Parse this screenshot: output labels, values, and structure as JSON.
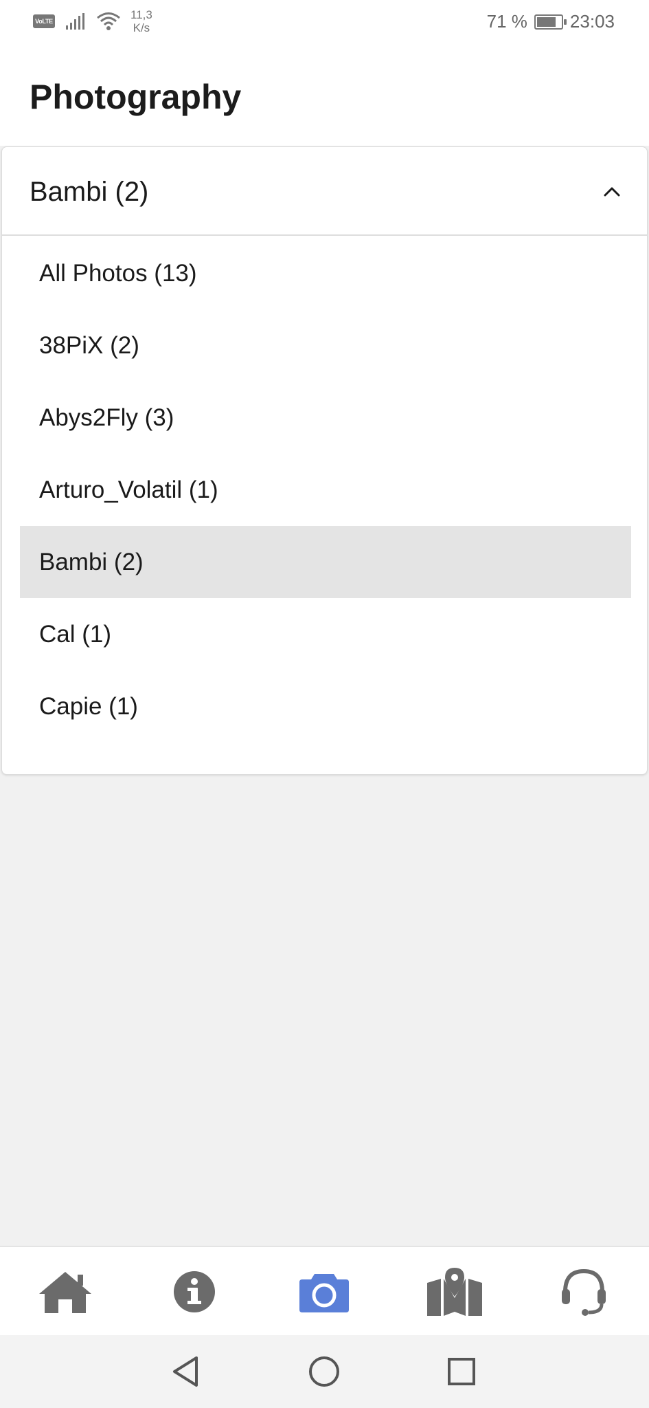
{
  "status_bar": {
    "network_badge": "VoLTE",
    "net_speed_value": "11,3",
    "net_speed_unit": "K/s",
    "battery": "71 %",
    "time": "23:03"
  },
  "header": {
    "title": "Photography"
  },
  "dropdown": {
    "selected": "Bambi (2)",
    "expanded": true,
    "options": [
      {
        "label": "All Photos (13)"
      },
      {
        "label": "38PiX (2)"
      },
      {
        "label": "Abys2Fly (3)"
      },
      {
        "label": "Arturo_Volatil (1)"
      },
      {
        "label": "Bambi (2)",
        "selected": true
      },
      {
        "label": "Cal (1)"
      },
      {
        "label": "Capie (1)"
      }
    ]
  },
  "tab_bar": {
    "tabs": [
      {
        "icon": "home-icon"
      },
      {
        "icon": "info-icon"
      },
      {
        "icon": "camera-icon",
        "active": true
      },
      {
        "icon": "map-icon"
      },
      {
        "icon": "headset-icon"
      }
    ],
    "active_color": "#5a7fd8",
    "inactive_color": "#6b6b6b"
  },
  "nav_bar": {
    "buttons": [
      "back-icon",
      "home-circle-icon",
      "recents-icon"
    ]
  }
}
